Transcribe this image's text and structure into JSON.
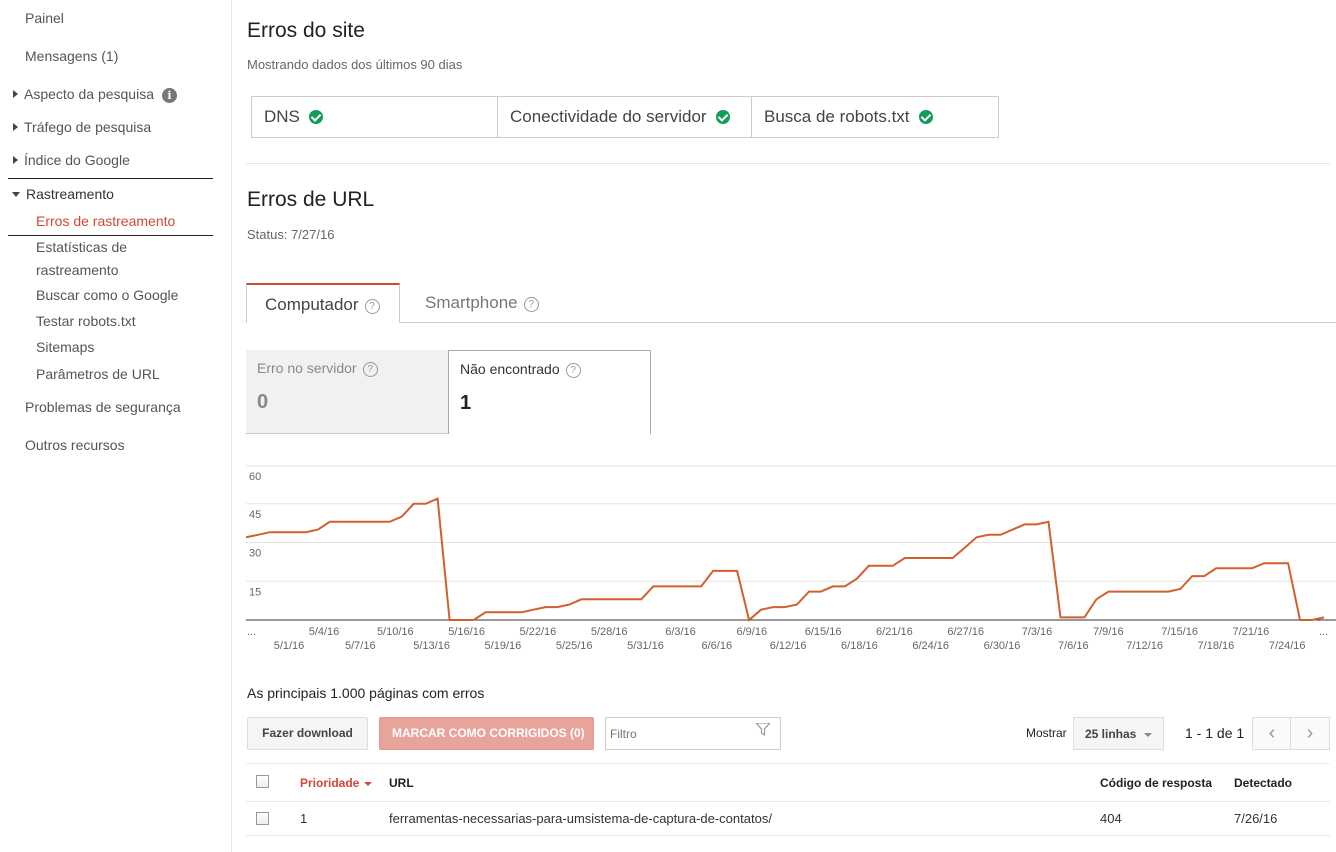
{
  "sidebar": {
    "painel": "Painel",
    "mensagens": "Mensagens (1)",
    "aspecto": "Aspecto da pesquisa",
    "trafego": "Tráfego de pesquisa",
    "indice": "Índice do Google",
    "rastreamento": "Rastreamento",
    "sub": [
      "Erros de rastreamento",
      "Estatísticas de",
      "rastreamento",
      "Buscar como o Google",
      "Testar robots.txt",
      "Sitemaps",
      "Parâmetros de URL"
    ],
    "seguranca": "Problemas de segurança",
    "outros": "Outros recursos"
  },
  "site_errors": {
    "title": "Erros do site",
    "subtitle": "Mostrando dados dos últimos 90 dias",
    "items": [
      "DNS",
      "Conectividade do servidor",
      "Busca de robots.txt"
    ]
  },
  "url_errors": {
    "title": "Erros de URL",
    "status": "Status: 7/27/16",
    "tabs": [
      "Computador",
      "Smartphone"
    ],
    "metrics": [
      {
        "label": "Erro no servidor",
        "value": "0"
      },
      {
        "label": "Não encontrado",
        "value": "1"
      }
    ]
  },
  "chart_data": {
    "type": "line",
    "color": "#d0612e",
    "ylim": [
      0,
      60
    ],
    "yticks": [
      "60",
      "45",
      "30",
      "15"
    ],
    "xticks_top": [
      "5/4/16",
      "5/10/16",
      "5/16/16",
      "5/22/16",
      "5/28/16",
      "6/3/16",
      "6/9/16",
      "6/15/16",
      "6/21/16",
      "6/27/16",
      "7/3/16",
      "7/9/16",
      "7/15/16",
      "7/21/16"
    ],
    "xticks_bottom": [
      "5/1/16",
      "5/7/16",
      "5/13/16",
      "5/19/16",
      "5/25/16",
      "5/31/16",
      "6/6/16",
      "6/12/16",
      "6/18/16",
      "6/24/16",
      "6/30/16",
      "7/6/16",
      "7/12/16",
      "7/18/16",
      "7/24/16"
    ],
    "ellipsis": "...",
    "values": [
      32,
      33,
      34,
      34,
      34,
      34,
      35,
      38,
      38,
      38,
      38,
      38,
      38,
      40,
      45,
      45,
      47,
      0,
      0,
      0,
      3,
      3,
      3,
      3,
      4,
      5,
      5,
      6,
      8,
      8,
      8,
      8,
      8,
      8,
      13,
      13,
      13,
      13,
      13,
      19,
      19,
      19,
      0,
      4,
      5,
      5,
      6,
      11,
      11,
      13,
      13,
      16,
      21,
      21,
      21,
      24,
      24,
      24,
      24,
      24,
      28,
      32,
      33,
      33,
      35,
      37,
      37,
      38,
      1,
      1,
      1,
      8,
      11,
      11,
      11,
      11,
      11,
      11,
      12,
      17,
      17,
      20,
      20,
      20,
      20,
      22,
      22,
      22,
      0,
      0,
      1
    ]
  },
  "table_section": {
    "title": "As principais 1.000 páginas com erros",
    "download": "Fazer download",
    "mark_fixed": "MARCAR COMO CORRIGIDOS (0)",
    "filter_placeholder": "Filtro",
    "show_label": "Mostrar",
    "rows_select": "25 linhas",
    "range": "1 - 1 de 1",
    "prev": "‹",
    "next": "›",
    "headers": {
      "priority": "Prioridade",
      "url": "URL",
      "code": "Código de resposta",
      "detected": "Detectado"
    },
    "rows": [
      {
        "priority": "1",
        "url": "ferramentas-necessarias-para-umsistema-de-captura-de-contatos/",
        "code": "404",
        "detected": "7/26/16"
      }
    ]
  }
}
